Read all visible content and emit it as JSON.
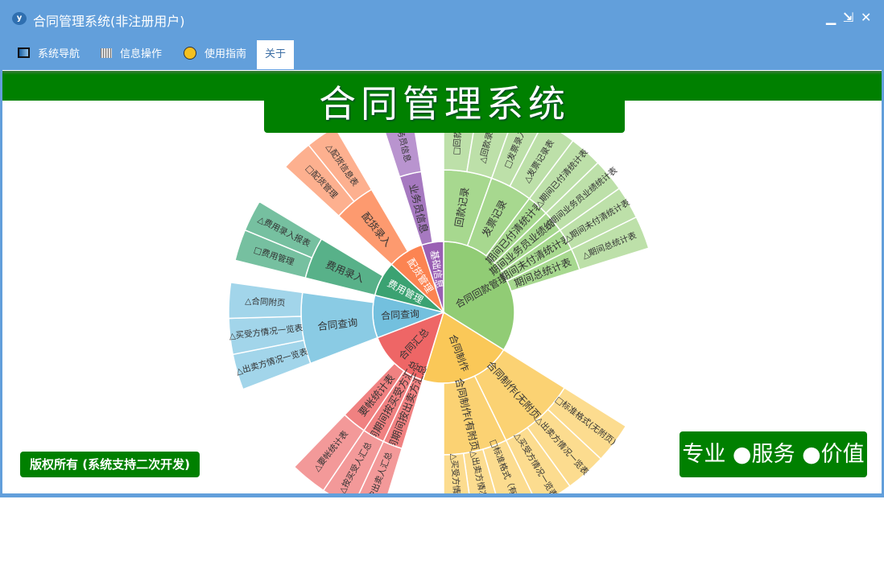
{
  "window": {
    "title": "合同管理系统(非注册用户)",
    "app_icon": "y",
    "minimize": "▁",
    "restore": "⇲",
    "close": "✕"
  },
  "menu": [
    {
      "label": "系统导航",
      "icon": "monitor-icon"
    },
    {
      "label": "信息操作",
      "icon": "grid-icon"
    },
    {
      "label": "使用指南",
      "icon": "help-icon"
    },
    {
      "label": "关于",
      "icon": ""
    }
  ],
  "banner": {
    "title": "合同管理系统"
  },
  "footer": {
    "copyright": "版权所有 (系统支持二次开发)",
    "slogan": "专业 ●服务 ●价值"
  },
  "chart_data": {
    "type": "sunburst",
    "title": "",
    "palette": [
      [
        "#91cc75",
        "#a7d88f",
        "#bde0a9"
      ],
      [
        "#fac858",
        "#fbd273",
        "#fcdc8f"
      ],
      [
        "#ee6666",
        "#f08181",
        "#f39999"
      ],
      [
        "#73c0de",
        "#8acbe4",
        "#a2d5ea"
      ],
      [
        "#3ba272",
        "#58b189",
        "#76c0a0"
      ],
      [
        "#fc8452",
        "#fd9a6f",
        "#fdb08f"
      ],
      [
        "#9a60b4",
        "#a679c0",
        "#b994cf"
      ]
    ],
    "nodes": [
      {
        "name": "合同回款管理",
        "value": 122,
        "children": [
          {
            "name": "回款记录",
            "value": 19.7,
            "children": [
              {
                "name": "□回款录入",
                "value": 9.4
              },
              {
                "name": "△回款录入表",
                "value": 10.3
              }
            ]
          },
          {
            "name": "发票记录",
            "value": 17.3,
            "children": [
              {
                "name": "□发票录入",
                "value": 8
              },
              {
                "name": "△发票记录表",
                "value": 9.3
              }
            ]
          },
          {
            "name": "期间已付清统计表",
            "value": 8.9,
            "children": [
              {
                "name": "△期间已付清统计表",
                "value": 8.9
              }
            ]
          },
          {
            "name": "期间业务员业绩统计",
            "value": 8.9,
            "children": [
              {
                "name": "△期间业务员业绩统计表",
                "value": 8.9
              }
            ]
          },
          {
            "name": "期间未付清统计表",
            "value": 8.9,
            "children": [
              {
                "name": "△期间未付清统计表",
                "value": 8.9
              }
            ]
          },
          {
            "name": "期间总统计表",
            "value": 8.9,
            "children": [
              {
                "name": "△期间总统计表",
                "value": 8.9
              }
            ]
          }
        ]
      },
      {
        "name": "合同制作",
        "value": 75,
        "children": [
          {
            "name": "合同制作(无附页)",
            "value": 32,
            "children": [
              {
                "name": "□标准格式(无附页)",
                "value": 11
              },
              {
                "name": "△出卖方情况一览表",
                "value": 11
              },
              {
                "name": "△买受方情况一览表",
                "value": 10
              }
            ]
          },
          {
            "name": "合同制作(有附页)",
            "value": 26,
            "children": [
              {
                "name": "□标准格式（有附页）",
                "value": 10
              },
              {
                "name": "△出卖方情况一览表",
                "value": 8
              },
              {
                "name": "△买受方情况一览表",
                "value": 8
              }
            ]
          }
        ]
      },
      {
        "name": "合同汇总",
        "value": 52,
        "children": [
          {
            "name": "合同期间按出卖方汇总",
            "value": 8,
            "children": [
              {
                "name": "△按出卖人汇总",
                "value": 8
              }
            ]
          },
          {
            "name": "合同期间按买受方汇总",
            "value": 9,
            "children": [
              {
                "name": "△按买受人汇总",
                "value": 9
              }
            ]
          },
          {
            "name": "要帐统计表",
            "value": 10,
            "children": [
              {
                "name": "△要帐统计表",
                "value": 10
              }
            ]
          }
        ]
      },
      {
        "name": "合同查询",
        "value": 35,
        "children": [
          {
            "name": "合同查询",
            "value": 29,
            "children": [
              {
                "name": "△出卖方情况一览表",
                "value": 9.7
              },
              {
                "name": "△买受方情况一览表",
                "value": 9.7
              },
              {
                "name": "△合同附页",
                "value": 9.6
              }
            ]
          }
        ]
      },
      {
        "name": "费用管理",
        "value": 28.6,
        "children": [
          {
            "name": "费用录入",
            "value": 17,
            "children": [
              {
                "name": "□费用管理",
                "value": 8.5
              },
              {
                "name": "△费用录入报表",
                "value": 8.5
              }
            ]
          }
        ]
      },
      {
        "name": "配货管理",
        "value": 29.4,
        "children": [
          {
            "name": "配货录入",
            "value": 17,
            "children": [
              {
                "name": "□配货管理",
                "value": 8.5
              },
              {
                "name": "△配货信息表",
                "value": 8.5
              }
            ]
          }
        ]
      },
      {
        "name": "基础信息",
        "value": 18,
        "children": [
          {
            "name": "业务员信息",
            "value": 9,
            "children": [
              {
                "name": "△业务员信息",
                "value": 9
              }
            ]
          }
        ]
      }
    ]
  }
}
